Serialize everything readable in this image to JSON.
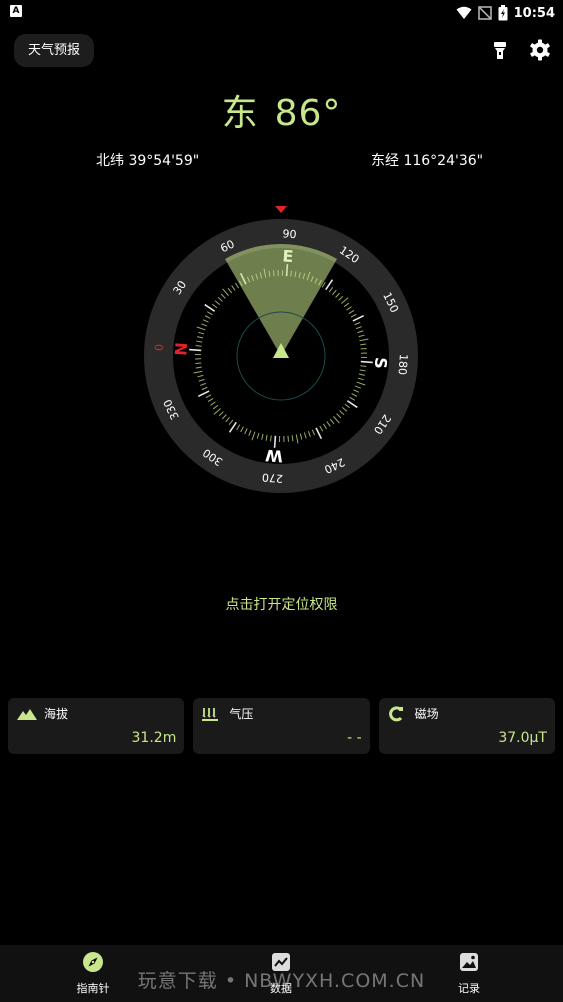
{
  "status_bar": {
    "time": "10:54"
  },
  "header": {
    "weather_button": "天气预报"
  },
  "heading": {
    "direction": "东",
    "degrees": "86°"
  },
  "coords": {
    "latitude": "北纬 39°54'59\"",
    "longitude": "东经 116°24'36\""
  },
  "compass": {
    "bearing_deg": 86,
    "ring_numbers": [
      "0",
      "30",
      "60",
      "90",
      "120",
      "150",
      "180",
      "210",
      "240",
      "270",
      "300",
      "330"
    ],
    "cardinals": {
      "north": "N",
      "east": "E",
      "south": "S",
      "west": "W"
    }
  },
  "permission": {
    "text": "点击打开定位权限"
  },
  "cards": [
    {
      "label": "海拔",
      "value": "31.2m",
      "icon": "mountain-icon"
    },
    {
      "label": "气压",
      "value": "- -",
      "icon": "pressure-icon"
    },
    {
      "label": "磁场",
      "value": "37.0μT",
      "icon": "magnet-icon"
    }
  ],
  "nav": [
    {
      "label": "指南针",
      "icon": "compass-icon"
    },
    {
      "label": "数据",
      "icon": "chart-icon"
    },
    {
      "label": "记录",
      "icon": "image-icon"
    }
  ],
  "watermark": "玩意下载 • NBWYXH.COM.CN",
  "colors": {
    "accent": "#c8e68c",
    "north": "#e0242b",
    "card_bg": "#1a1a1a"
  }
}
